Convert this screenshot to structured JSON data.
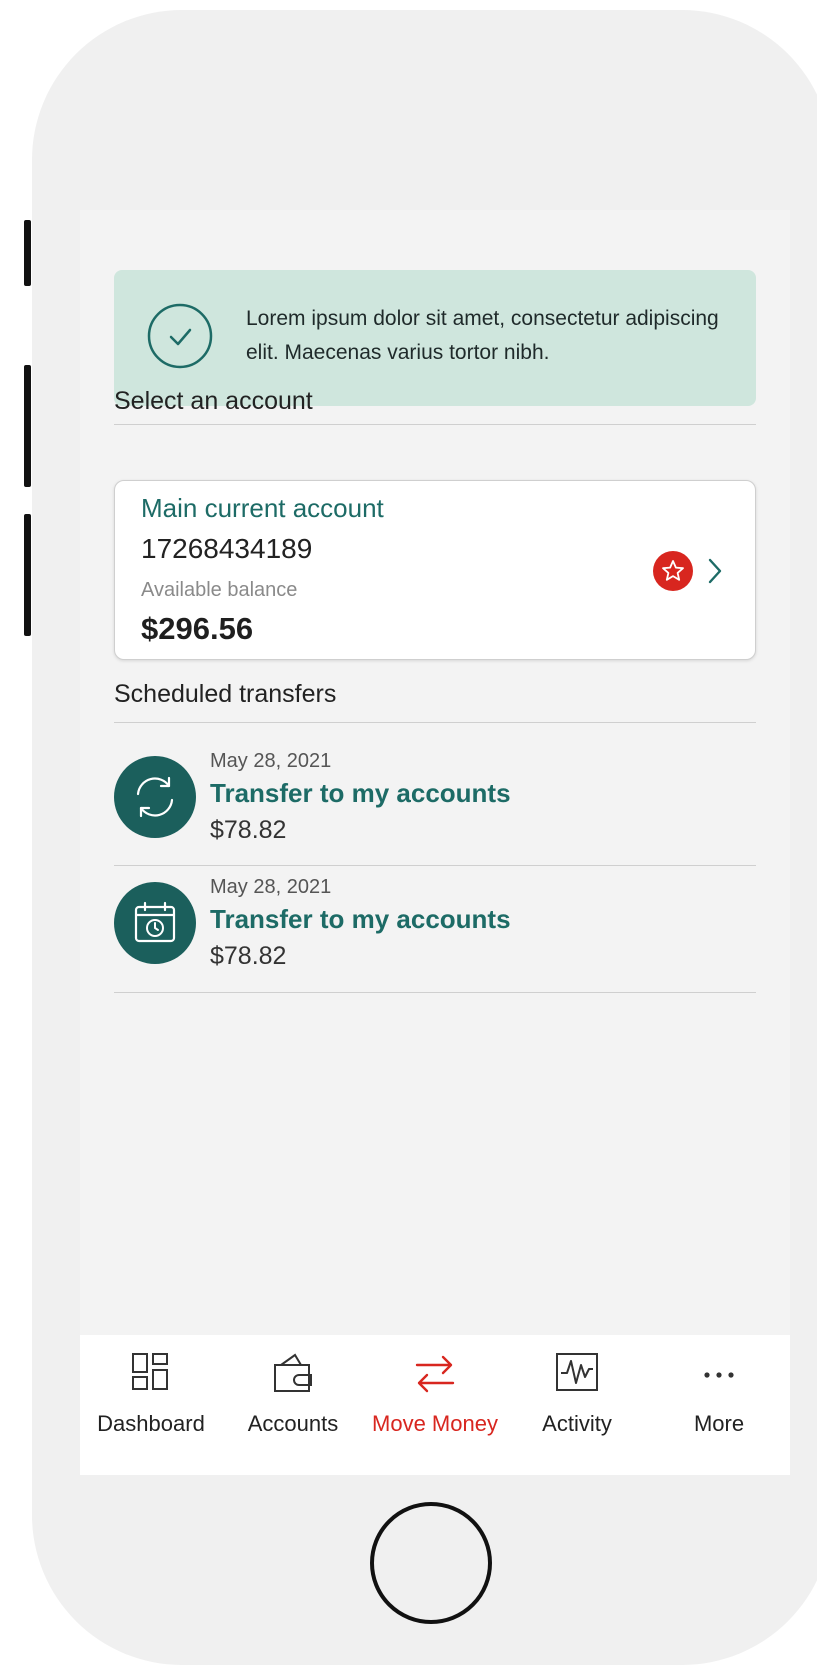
{
  "alert": {
    "message": "Lorem ipsum dolor sit amet, consectetur adipiscing elit. Maecenas varius tortor nibh."
  },
  "account_section": {
    "title": "Select an account"
  },
  "account": {
    "name": "Main current account",
    "number": "17268434189",
    "balance_label": "Available balance",
    "balance": "$296.56"
  },
  "transfers_section": {
    "title": "Scheduled transfers",
    "items": [
      {
        "date": "May 28, 2021",
        "name": "Transfer to my accounts",
        "amount": "$78.82",
        "icon": "recurring-icon"
      },
      {
        "date": "May 28, 2021",
        "name": "Transfer to my accounts",
        "amount": "$78.82",
        "icon": "calendar-clock-icon"
      }
    ]
  },
  "tabbar": {
    "tabs": [
      {
        "label": "Dashboard",
        "icon": "dashboard-icon"
      },
      {
        "label": "Accounts",
        "icon": "wallet-icon"
      },
      {
        "label": "Move Money",
        "icon": "transfer-arrows-icon",
        "active": true
      },
      {
        "label": "Activity",
        "icon": "activity-icon"
      },
      {
        "label": "More",
        "icon": "more-icon"
      }
    ]
  },
  "colors": {
    "brand_teal": "#1d6b66",
    "alert_bg": "#cfe6dd",
    "accent_red": "#d8261f"
  }
}
